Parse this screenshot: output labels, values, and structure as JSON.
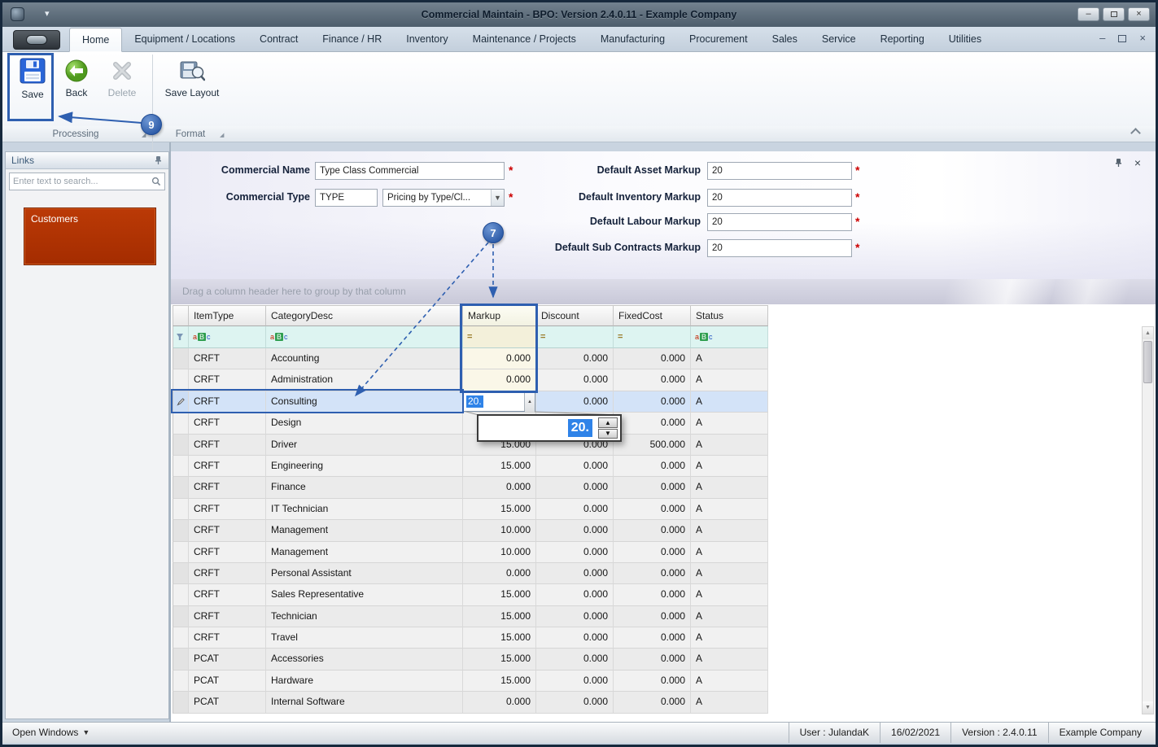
{
  "window": {
    "title": "Commercial Maintain - BPO: Version 2.4.0.11 - Example Company"
  },
  "icons": {
    "caret_down": "▾",
    "minimize": "–",
    "close": "×",
    "spin_up": "▲",
    "spin_down": "▼"
  },
  "ribbon": {
    "tabs": [
      {
        "label": "Home",
        "active": true
      },
      {
        "label": "Equipment / Locations"
      },
      {
        "label": "Contract"
      },
      {
        "label": "Finance / HR"
      },
      {
        "label": "Inventory"
      },
      {
        "label": "Maintenance / Projects"
      },
      {
        "label": "Manufacturing"
      },
      {
        "label": "Procurement"
      },
      {
        "label": "Sales"
      },
      {
        "label": "Service"
      },
      {
        "label": "Reporting"
      },
      {
        "label": "Utilities"
      }
    ],
    "buttons": {
      "save": "Save",
      "back": "Back",
      "delete": "Delete",
      "save_layout": "Save Layout"
    },
    "groups": {
      "processing": "Processing",
      "format": "Format"
    }
  },
  "links_panel": {
    "title": "Links",
    "search_placeholder": "Enter text to search...",
    "items": [
      {
        "label": "Customers"
      }
    ]
  },
  "form": {
    "required_mark": "*",
    "name_label": "Commercial Name",
    "name_value": "Type Class Commercial",
    "type_label": "Commercial Type",
    "type_value": "TYPE",
    "type_select_value": "Pricing by Type/Cl...",
    "right_fields": [
      {
        "label": "Default Asset Markup",
        "value": "20"
      },
      {
        "label": "Default Inventory Markup",
        "value": "20"
      },
      {
        "label": "Default Labour Markup",
        "value": "20"
      },
      {
        "label": "Default Sub Contracts Markup",
        "value": "20"
      }
    ]
  },
  "grid": {
    "group_hint": "Drag a column header here to group by that column",
    "columns": [
      "ItemType",
      "CategoryDesc",
      "Markup",
      "Discount",
      "FixedCost",
      "Status"
    ],
    "filter_numeric_glyph": "=",
    "filter_text_glyph": {
      "a": "a",
      "b": "B",
      "c": "c"
    },
    "editor": {
      "value": "20."
    },
    "rows": [
      {
        "item_type": "CRFT",
        "category": "Accounting",
        "markup": "0.000",
        "discount": "0.000",
        "fixed_cost": "0.000",
        "status": "A"
      },
      {
        "item_type": "CRFT",
        "category": "Administration",
        "markup": "0.000",
        "discount": "0.000",
        "fixed_cost": "0.000",
        "status": "A"
      },
      {
        "item_type": "CRFT",
        "category": "Consulting",
        "markup": "",
        "discount": "0.000",
        "fixed_cost": "0.000",
        "status": "A",
        "editing": true
      },
      {
        "item_type": "CRFT",
        "category": "Design",
        "markup": "",
        "discount": "",
        "fixed_cost": "0.000",
        "status": "A"
      },
      {
        "item_type": "CRFT",
        "category": "Driver",
        "markup": "15.000",
        "discount": "0.000",
        "fixed_cost": "500.000",
        "status": "A"
      },
      {
        "item_type": "CRFT",
        "category": "Engineering",
        "markup": "15.000",
        "discount": "0.000",
        "fixed_cost": "0.000",
        "status": "A"
      },
      {
        "item_type": "CRFT",
        "category": "Finance",
        "markup": "0.000",
        "discount": "0.000",
        "fixed_cost": "0.000",
        "status": "A"
      },
      {
        "item_type": "CRFT",
        "category": "IT Technician",
        "markup": "15.000",
        "discount": "0.000",
        "fixed_cost": "0.000",
        "status": "A"
      },
      {
        "item_type": "CRFT",
        "category": "Management",
        "markup": "10.000",
        "discount": "0.000",
        "fixed_cost": "0.000",
        "status": "A"
      },
      {
        "item_type": "CRFT",
        "category": "Management",
        "markup": "10.000",
        "discount": "0.000",
        "fixed_cost": "0.000",
        "status": "A"
      },
      {
        "item_type": "CRFT",
        "category": "Personal Assistant",
        "markup": "0.000",
        "discount": "0.000",
        "fixed_cost": "0.000",
        "status": "A"
      },
      {
        "item_type": "CRFT",
        "category": "Sales Representative",
        "markup": "15.000",
        "discount": "0.000",
        "fixed_cost": "0.000",
        "status": "A"
      },
      {
        "item_type": "CRFT",
        "category": "Technician",
        "markup": "15.000",
        "discount": "0.000",
        "fixed_cost": "0.000",
        "status": "A"
      },
      {
        "item_type": "CRFT",
        "category": "Travel",
        "markup": "15.000",
        "discount": "0.000",
        "fixed_cost": "0.000",
        "status": "A"
      },
      {
        "item_type": "PCAT",
        "category": "Accessories",
        "markup": "15.000",
        "discount": "0.000",
        "fixed_cost": "0.000",
        "status": "A"
      },
      {
        "item_type": "PCAT",
        "category": "Hardware",
        "markup": "15.000",
        "discount": "0.000",
        "fixed_cost": "0.000",
        "status": "A"
      },
      {
        "item_type": "PCAT",
        "category": "Internal Software",
        "markup": "0.000",
        "discount": "0.000",
        "fixed_cost": "0.000",
        "status": "A"
      }
    ]
  },
  "annotations": {
    "step_7": "7",
    "step_9": "9"
  },
  "status_bar": {
    "open_windows_label": "Open Windows",
    "user": "User : JulandaK",
    "date": "16/02/2021",
    "version": "Version : 2.4.0.11",
    "company": "Example Company"
  },
  "colors": {
    "accent_blue": "#2e5fb0",
    "selection_blue": "#2f83e8",
    "customers_red": "#b23000",
    "required_red": "#cc0000"
  }
}
